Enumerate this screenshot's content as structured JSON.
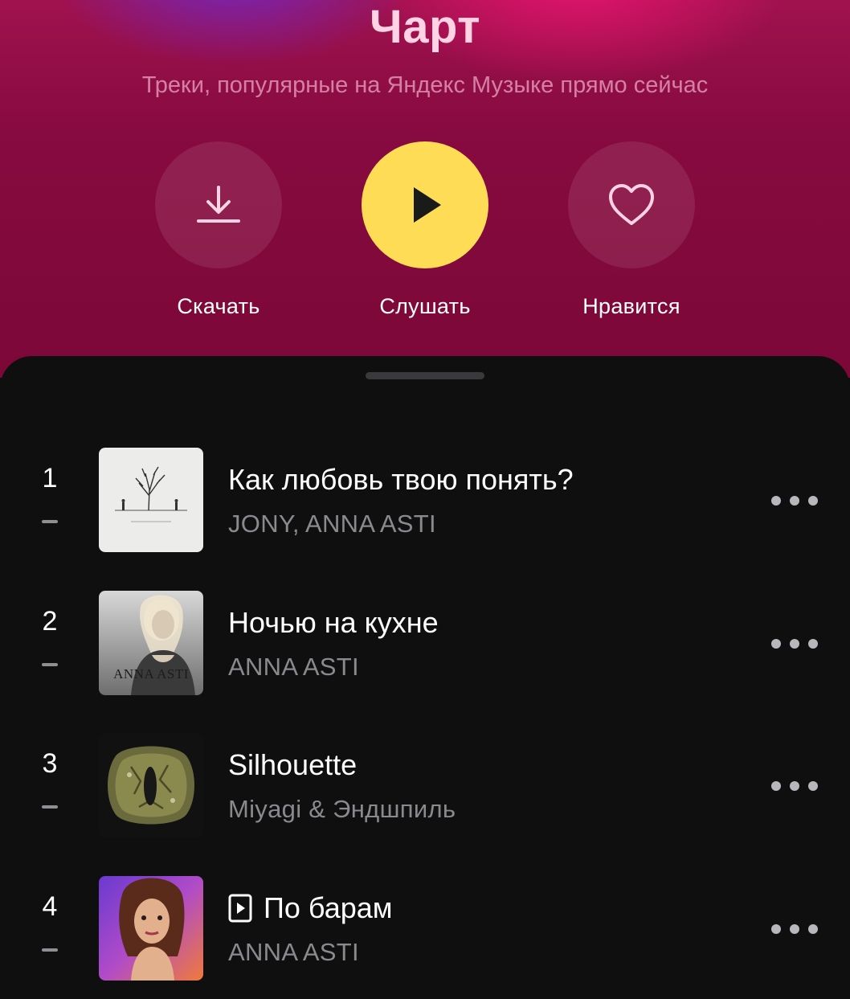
{
  "header": {
    "title": "Чарт",
    "subtitle": "Треки, популярные на Яндекс Музыке прямо сейчас"
  },
  "actions": {
    "download_label": "Скачать",
    "play_label": "Слушать",
    "like_label": "Нравится"
  },
  "colors": {
    "hero_background": "#870a40",
    "play_button": "#ffdc55",
    "sheet_background": "#0f0f10",
    "artist_text": "#8a8a8e"
  },
  "tracks": [
    {
      "rank": "1",
      "title": "Как любовь твою понять?",
      "artist": "JONY, ANNA ASTI",
      "has_video": false
    },
    {
      "rank": "2",
      "title": "Ночью на кухне",
      "artist": "ANNA ASTI",
      "has_video": false,
      "cover_text": "ANNA ASTI"
    },
    {
      "rank": "3",
      "title": "Silhouette",
      "artist": "Miyagi & Эндшпиль",
      "has_video": false
    },
    {
      "rank": "4",
      "title": "По барам",
      "artist": "ANNA ASTI",
      "has_video": true
    }
  ],
  "icons": {
    "download": "download-icon",
    "play": "play-icon",
    "like": "heart-icon",
    "more": "more-horizontal-icon",
    "video": "video-clip-icon"
  }
}
